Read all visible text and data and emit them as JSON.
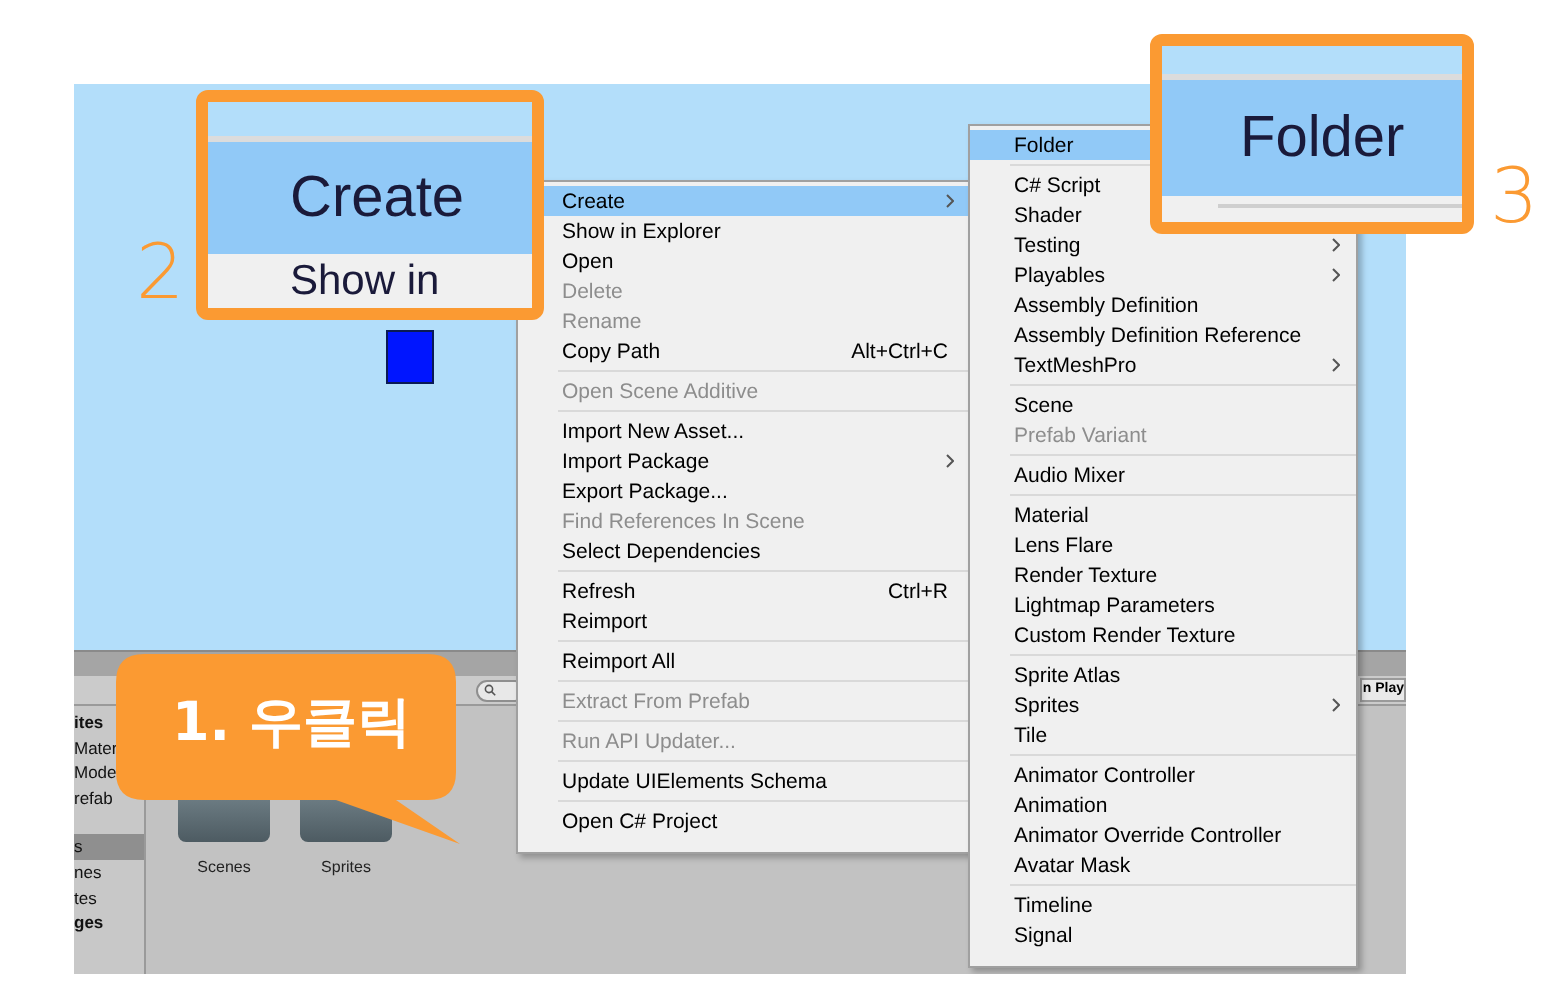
{
  "project": {
    "tree_groups": [
      [
        {
          "label": "ites",
          "bold": true,
          "selected": false
        },
        {
          "label": "Mater",
          "bold": false,
          "selected": false
        },
        {
          "label": "Mode",
          "bold": false,
          "selected": false
        },
        {
          "label": "refab",
          "bold": false,
          "selected": false
        }
      ],
      [
        {
          "label": "s",
          "bold": false,
          "selected": true
        },
        {
          "label": "nes",
          "bold": false,
          "selected": false
        },
        {
          "label": "tes",
          "bold": false,
          "selected": false
        },
        {
          "label": "ges",
          "bold": true,
          "selected": false
        }
      ]
    ],
    "assets": [
      {
        "label": "Scenes"
      },
      {
        "label": "Sprites"
      }
    ],
    "side_tab": "n Play"
  },
  "context_menu": [
    [
      {
        "label": "Create",
        "selected": true,
        "disabled": false,
        "submenu": true
      },
      {
        "label": "Show in Explorer",
        "selected": false,
        "disabled": false,
        "submenu": false
      },
      {
        "label": "Open",
        "selected": false,
        "disabled": false,
        "submenu": false
      },
      {
        "label": "Delete",
        "selected": false,
        "disabled": true,
        "submenu": false
      },
      {
        "label": "Rename",
        "selected": false,
        "disabled": true,
        "submenu": false
      },
      {
        "label": "Copy Path",
        "shortcut": "Alt+Ctrl+C",
        "selected": false,
        "disabled": false,
        "submenu": false
      }
    ],
    [
      {
        "label": "Open Scene Additive",
        "selected": false,
        "disabled": true,
        "submenu": false
      }
    ],
    [
      {
        "label": "Import New Asset...",
        "selected": false,
        "disabled": false,
        "submenu": false
      },
      {
        "label": "Import Package",
        "selected": false,
        "disabled": false,
        "submenu": true
      },
      {
        "label": "Export Package...",
        "selected": false,
        "disabled": false,
        "submenu": false
      },
      {
        "label": "Find References In Scene",
        "selected": false,
        "disabled": true,
        "submenu": false
      },
      {
        "label": "Select Dependencies",
        "selected": false,
        "disabled": false,
        "submenu": false
      }
    ],
    [
      {
        "label": "Refresh",
        "shortcut": "Ctrl+R",
        "selected": false,
        "disabled": false,
        "submenu": false
      },
      {
        "label": "Reimport",
        "selected": false,
        "disabled": false,
        "submenu": false
      }
    ],
    [
      {
        "label": "Reimport All",
        "selected": false,
        "disabled": false,
        "submenu": false
      }
    ],
    [
      {
        "label": "Extract From Prefab",
        "selected": false,
        "disabled": true,
        "submenu": false
      }
    ],
    [
      {
        "label": "Run API Updater...",
        "selected": false,
        "disabled": true,
        "submenu": false
      }
    ],
    [
      {
        "label": "Update UIElements Schema",
        "selected": false,
        "disabled": false,
        "submenu": false
      }
    ],
    [
      {
        "label": "Open C# Project",
        "selected": false,
        "disabled": false,
        "submenu": false
      }
    ]
  ],
  "create_submenu": [
    [
      {
        "label": "Folder",
        "selected": true,
        "disabled": false
      }
    ],
    [
      {
        "label": "C# Script",
        "selected": false,
        "disabled": false
      },
      {
        "label": "Shader",
        "selected": false,
        "disabled": false
      },
      {
        "label": "Testing",
        "selected": false,
        "disabled": false,
        "submenu": true
      },
      {
        "label": "Playables",
        "selected": false,
        "disabled": false,
        "submenu": true
      },
      {
        "label": "Assembly Definition",
        "selected": false,
        "disabled": false,
        "submenu": false
      },
      {
        "label": "Assembly Definition Reference",
        "selected": false,
        "disabled": false,
        "submenu": false
      },
      {
        "label": "TextMeshPro",
        "selected": false,
        "disabled": false,
        "submenu": true
      }
    ],
    [
      {
        "label": "Scene",
        "selected": false,
        "disabled": false,
        "submenu": false
      },
      {
        "label": "Prefab Variant",
        "selected": false,
        "disabled": true,
        "submenu": false
      }
    ],
    [
      {
        "label": "Audio Mixer",
        "selected": false,
        "disabled": false,
        "submenu": false
      }
    ],
    [
      {
        "label": "Material",
        "selected": false,
        "disabled": false,
        "submenu": false
      },
      {
        "label": "Lens Flare",
        "selected": false,
        "disabled": false,
        "submenu": false
      },
      {
        "label": "Render Texture",
        "selected": false,
        "disabled": false,
        "submenu": false
      },
      {
        "label": "Lightmap Parameters",
        "selected": false,
        "disabled": false,
        "submenu": false
      },
      {
        "label": "Custom Render Texture",
        "selected": false,
        "disabled": false,
        "submenu": false
      }
    ],
    [
      {
        "label": "Sprite Atlas",
        "selected": false,
        "disabled": false,
        "submenu": false
      },
      {
        "label": "Sprites",
        "selected": false,
        "disabled": false,
        "submenu": true
      },
      {
        "label": "Tile",
        "selected": false,
        "disabled": false,
        "submenu": false
      }
    ],
    [
      {
        "label": "Animator Controller",
        "selected": false,
        "disabled": false,
        "submenu": false
      },
      {
        "label": "Animation",
        "selected": false,
        "disabled": false,
        "submenu": false
      },
      {
        "label": "Animator Override Controller",
        "selected": false,
        "disabled": false,
        "submenu": false
      },
      {
        "label": "Avatar Mask",
        "selected": false,
        "disabled": false,
        "submenu": false
      }
    ],
    [
      {
        "label": "Timeline",
        "selected": false,
        "disabled": false,
        "submenu": false
      },
      {
        "label": "Signal",
        "selected": false,
        "disabled": false,
        "submenu": false
      }
    ]
  ],
  "speech_bubble": {
    "text": "1. 우클릭"
  },
  "callouts": [
    {
      "number": "2",
      "item": "Create",
      "next_item": "Show in"
    },
    {
      "number": "3",
      "item": "Folder"
    }
  ]
}
